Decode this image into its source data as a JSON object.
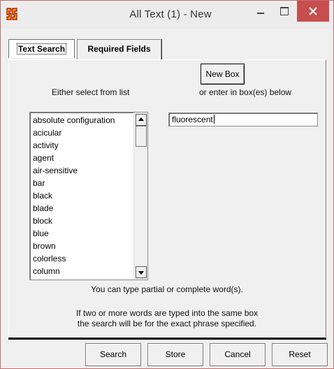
{
  "window": {
    "title": "All Text (1) - New"
  },
  "tabs": [
    {
      "label": "Text Search"
    },
    {
      "label": "Required Fields"
    }
  ],
  "main": {
    "new_box_label": "New Box",
    "select_label": "Either select from list",
    "enter_label": "or enter in box(es) below",
    "list_items": [
      "absolute configuration",
      "acicular",
      "activity",
      "agent",
      "air-sensitive",
      "bar",
      "black",
      "blade",
      "block",
      "blue",
      "brown",
      "colorless",
      "column"
    ],
    "box_value": "fluorescent",
    "hint_partial": "You can type partial or complete word(s).",
    "hint_phrase_line1": "If two or more words are typed into the same box",
    "hint_phrase_line2": "the search will be for the exact phrase specified."
  },
  "footer": {
    "search_label": "Search",
    "store_label": "Store",
    "cancel_label": "Cancel",
    "reset_label": "Reset"
  },
  "colors": {
    "close_button": "#c74e4e",
    "window_bg": "#f0f0f0",
    "app_icon": "#e8a200"
  }
}
